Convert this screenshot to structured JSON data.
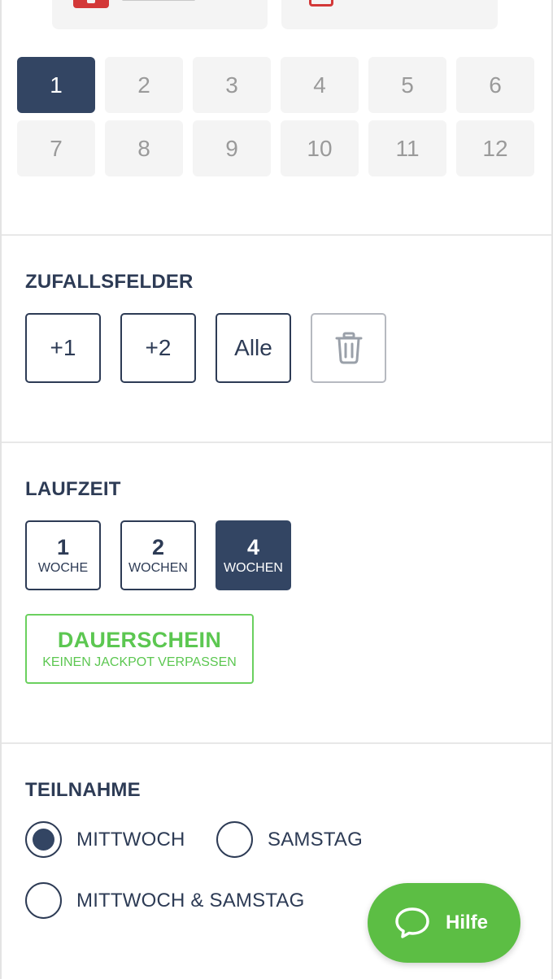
{
  "numbers": [
    "1",
    "2",
    "3",
    "4",
    "5",
    "6",
    "7",
    "8",
    "9",
    "10",
    "11",
    "12"
  ],
  "selected_number": "1",
  "zufallsfelder": {
    "title": "ZUFALLSFELDER",
    "buttons": [
      "+1",
      "+2",
      "Alle"
    ],
    "delete_icon": "trash-icon"
  },
  "laufzeit": {
    "title": "LAUFZEIT",
    "options": [
      {
        "value": "1",
        "unit": "WOCHE"
      },
      {
        "value": "2",
        "unit": "WOCHEN"
      },
      {
        "value": "4",
        "unit": "WOCHEN"
      }
    ],
    "selected": "4",
    "dauerschein": {
      "title": "DAUERSCHEIN",
      "subtitle": "KEINEN JACKPOT VERPASSEN"
    }
  },
  "teilnahme": {
    "title": "TEILNAHME",
    "options": [
      "MITTWOCH",
      "SAMSTAG",
      "MITTWOCH & SAMSTAG"
    ],
    "selected": "MITTWOCH"
  },
  "help_button": {
    "label": "Hilfe",
    "icon": "chat-bubble-icon"
  },
  "colors": {
    "primary": "#334563",
    "accent_green": "#5cbe44",
    "error_red": "#d33838"
  }
}
